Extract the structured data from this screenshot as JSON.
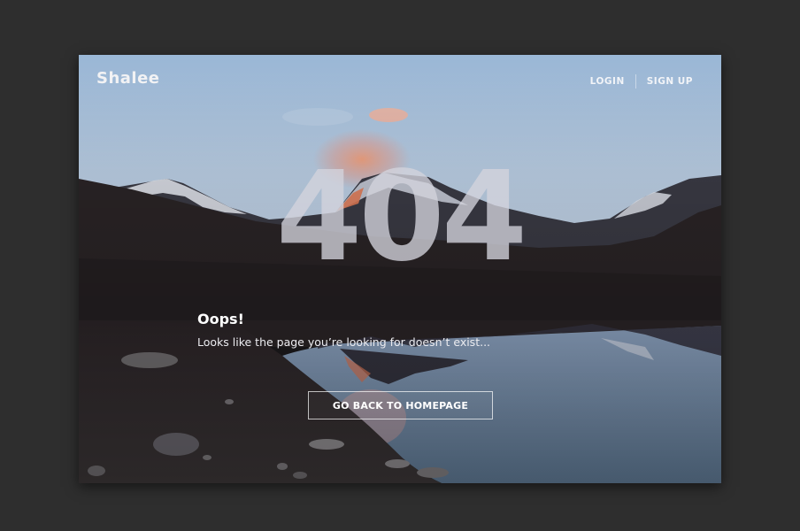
{
  "brand": {
    "name": "Shalee"
  },
  "nav": {
    "login_label": "LOGIN",
    "signup_label": "SIGN UP"
  },
  "error": {
    "code": "404",
    "headline": "Oops!",
    "message": "Looks like the page you’re looking for doesn’t exist...",
    "cta_label": "GO BACK TO HOMEPAGE"
  }
}
